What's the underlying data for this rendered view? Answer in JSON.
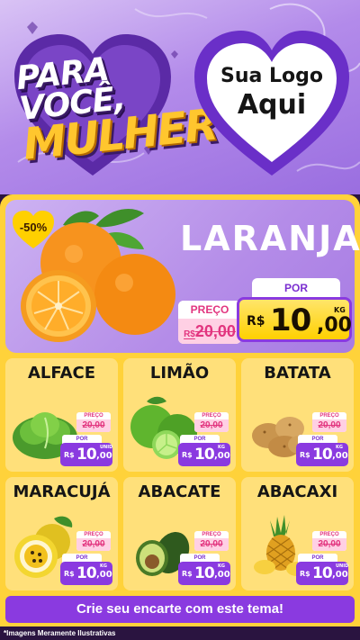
{
  "header": {
    "headline_line1": "PARA VOCÊ,",
    "headline_line2": "MULHER",
    "logo_line1": "Sua Logo",
    "logo_line2": "Aqui"
  },
  "featured": {
    "discount": "-50%",
    "name": "LARANJA",
    "preco_label": "PREÇO",
    "old_currency": "R$",
    "old_price": "20,00",
    "por_label": "POR",
    "currency": "R$",
    "price_int": "10",
    "price_dec": ",00",
    "unit": "KG"
  },
  "products": [
    {
      "name": "ALFACE",
      "icon": "lettuce-icon",
      "preco_label": "PREÇO",
      "old_price": "20,00",
      "por_label": "POR",
      "currency": "R$",
      "price_int": "10",
      "price_dec": ",00",
      "unit": "UNID"
    },
    {
      "name": "LIMÃO",
      "icon": "lime-icon",
      "preco_label": "PREÇO",
      "old_price": "20,00",
      "por_label": "POR",
      "currency": "R$",
      "price_int": "10",
      "price_dec": ",00",
      "unit": "KG"
    },
    {
      "name": "BATATA",
      "icon": "potato-icon",
      "preco_label": "PREÇO",
      "old_price": "20,00",
      "por_label": "POR",
      "currency": "R$",
      "price_int": "10",
      "price_dec": ",00",
      "unit": "KG"
    },
    {
      "name": "MARACUJÁ",
      "icon": "passion-fruit-icon",
      "preco_label": "PREÇO",
      "old_price": "20,00",
      "por_label": "POR",
      "currency": "R$",
      "price_int": "10",
      "price_dec": ",00",
      "unit": "KG"
    },
    {
      "name": "ABACATE",
      "icon": "avocado-icon",
      "preco_label": "PREÇO",
      "old_price": "20,00",
      "por_label": "POR",
      "currency": "R$",
      "price_int": "10",
      "price_dec": ",00",
      "unit": "KG"
    },
    {
      "name": "ABACAXI",
      "icon": "pineapple-icon",
      "preco_label": "PREÇO",
      "old_price": "20,00",
      "por_label": "POR",
      "currency": "R$",
      "price_int": "10",
      "price_dec": ",00",
      "unit": "UNID"
    }
  ],
  "cta": "Crie seu encarte com este tema!",
  "footnote": "*Imagens Meramente Ilustrativas",
  "colors": {
    "purple": "#8a3ae0",
    "lilac": "#b48ce8",
    "yellow": "#ffd23a",
    "pink": "#e2357f"
  }
}
